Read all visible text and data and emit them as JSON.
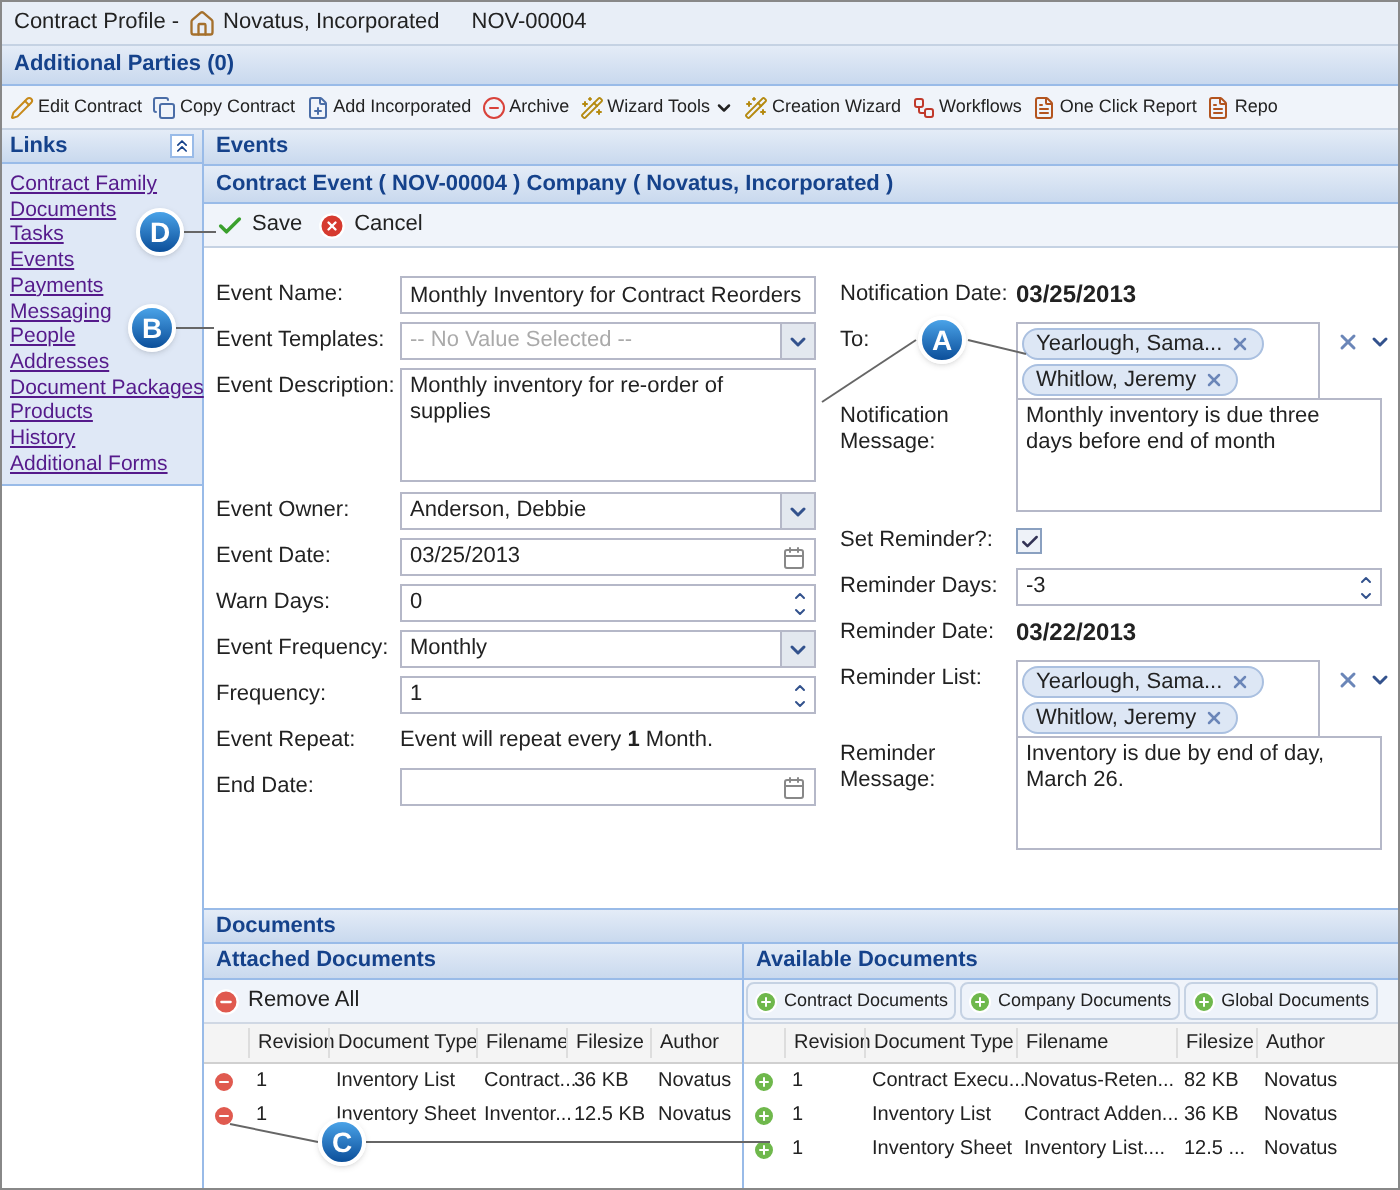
{
  "header": {
    "prefix": "Contract Profile -",
    "company": "Novatus, Incorporated",
    "contract_id": "NOV-00004"
  },
  "additional_parties": "Additional Parties (0)",
  "toolbar": [
    {
      "label": "Edit Contract",
      "kind": "edit"
    },
    {
      "label": "Copy Contract",
      "kind": "copy"
    },
    {
      "label": "Add Incorporated",
      "kind": "add"
    },
    {
      "label": "Archive",
      "kind": "archive"
    },
    {
      "label": "Wizard Tools",
      "kind": "wizard",
      "dropdown": true
    },
    {
      "label": "Creation Wizard",
      "kind": "wizard",
      "dropdown": false
    },
    {
      "label": "Workflows",
      "kind": "workflow"
    },
    {
      "label": "One Click Report",
      "kind": "report"
    },
    {
      "label": "Repo",
      "kind": "report"
    }
  ],
  "links": {
    "title": "Links",
    "items": [
      "Contract Family",
      "Documents",
      "Tasks",
      "Events",
      "Payments",
      "Messaging",
      "People",
      "Addresses",
      "Document Packages",
      "Products",
      "History",
      "Additional Forms"
    ]
  },
  "events_title": "Events",
  "form_title": "Contract Event ( NOV-00004 ) Company ( Novatus, Incorporated )",
  "actions": [
    {
      "label": "Save",
      "kind": "save"
    },
    {
      "label": "Cancel",
      "kind": "cancel"
    }
  ],
  "left_fields": [
    {
      "label": "Event Name:",
      "kind": "text",
      "value": "Monthly Inventory for Contract Reorders"
    },
    {
      "label": "Event Templates:",
      "kind": "select",
      "placeholder": "-- No Value Selected --"
    },
    {
      "label": "Event Description:",
      "kind": "textarea",
      "value": "Monthly inventory for re-order of supplies"
    },
    {
      "label": "Event Owner:",
      "kind": "select",
      "value": "Anderson, Debbie"
    },
    {
      "label": "Event Date:",
      "kind": "date",
      "value": "03/25/2013"
    },
    {
      "label": "Warn Days:",
      "kind": "spinner",
      "value": "0"
    },
    {
      "label": "Event Frequency:",
      "kind": "select",
      "value": "Monthly"
    },
    {
      "label": "Frequency:",
      "kind": "spinner",
      "value": "1"
    },
    {
      "label": "Event Repeat:",
      "kind": "static",
      "value": "Event will repeat every **1** Month."
    },
    {
      "label": "End Date:",
      "kind": "date"
    }
  ],
  "right_fields": [
    {
      "label": "Notification Date:",
      "kind": "readonly",
      "value": "03/25/2013"
    },
    {
      "label": "To:",
      "kind": "tags",
      "tags": [
        "Yearlough, Sama...",
        "Whitlow, Jeremy"
      ]
    },
    {
      "label": "Notification Message:",
      "kind": "textarea",
      "value": "Monthly inventory is due three days before end of month"
    },
    {
      "label": "Set Reminder?:",
      "kind": "checkbox",
      "checked": true
    },
    {
      "label": "Reminder Days:",
      "kind": "spinner",
      "value": "-3"
    },
    {
      "label": "Reminder Date:",
      "kind": "readonly",
      "value": "03/22/2013"
    },
    {
      "label": "Reminder List:",
      "kind": "tags",
      "tags": [
        "Yearlough, Sama...",
        "Whitlow, Jeremy"
      ]
    },
    {
      "label": "Reminder Message:",
      "kind": "textarea",
      "value": "Inventory is due by end of day, March 26."
    }
  ],
  "documents": {
    "title": "Documents",
    "attached": {
      "title": "Attached Documents",
      "remove_all": "Remove All",
      "columns": [
        "Revision",
        "Document Type",
        "Filename",
        "Filesize",
        "Author"
      ],
      "rows": [
        [
          "1",
          "Inventory List",
          "Contract...",
          "36 KB",
          "Novatus"
        ],
        [
          "1",
          "Inventory Sheet",
          "Inventor...",
          "12.5 KB",
          "Novatus"
        ]
      ]
    },
    "available": {
      "title": "Available Documents",
      "tabs": [
        "Contract Documents",
        "Company Documents",
        "Global Documents"
      ],
      "columns": [
        "Revision",
        "Document Type",
        "Filename",
        "Filesize",
        "Author"
      ],
      "rows": [
        [
          "1",
          "Contract Execu...",
          "Novatus-Reten...",
          "82 KB",
          "Novatus"
        ],
        [
          "1",
          "Inventory List",
          "Contract Adden...",
          "36 KB",
          "Novatus"
        ],
        [
          "1",
          "Inventory Sheet",
          "Inventory List....",
          "12.5 ...",
          "Novatus"
        ]
      ]
    }
  },
  "callouts": [
    "A",
    "B",
    "C",
    "D"
  ]
}
